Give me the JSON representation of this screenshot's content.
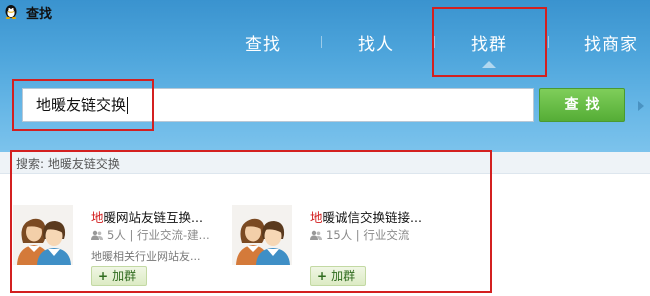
{
  "app": {
    "title": "查找",
    "icon": "qq-penguin-icon"
  },
  "nav": {
    "tabs": [
      {
        "label": "查找"
      },
      {
        "label": "找人"
      },
      {
        "label": "找群",
        "active": true
      },
      {
        "label": "找商家"
      }
    ]
  },
  "search": {
    "value": "地暖友链交换",
    "button_label": "查找"
  },
  "results": {
    "label": "搜索: 地暖友链交换",
    "items": [
      {
        "name_highlight": "地",
        "name_rest": "暖网站友链互换...",
        "members": "5人",
        "category": "行业交流-建...",
        "desc": "地暖相关行业网站友...",
        "join_label": "加群"
      },
      {
        "name_highlight": "地",
        "name_rest": "暖诚信交换链接...",
        "members": "15人",
        "category": "行业交流",
        "desc": "",
        "join_label": "加群"
      }
    ]
  },
  "colors": {
    "header_top": "#3a93cf",
    "header_bottom": "#7cc3ec",
    "search_button": "#55ad36",
    "highlight": "#d11c1c",
    "annotation_box": "#d32020"
  }
}
